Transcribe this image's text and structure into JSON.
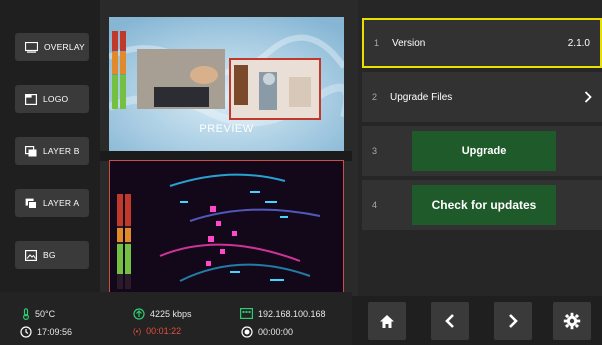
{
  "sources": [
    {
      "label": "OVERLAY",
      "icon": "overlay-icon"
    },
    {
      "label": "LOGO",
      "icon": "logo-icon"
    },
    {
      "label": "LAYER B",
      "icon": "layer-b-icon"
    },
    {
      "label": "LAYER A",
      "icon": "layer-a-icon"
    },
    {
      "label": "BG",
      "icon": "image-icon"
    }
  ],
  "preview": {
    "label": "PREVIEW"
  },
  "status": {
    "temperature": "50°C",
    "bitrate": "4225 kbps",
    "ip": "192.168.100.168",
    "clock": "17:09:56",
    "live_time": "00:01:22",
    "record_time": "00:00:00"
  },
  "menu": {
    "rows": [
      {
        "num": "1",
        "label": "Version",
        "value": "2.1.0"
      },
      {
        "num": "2",
        "label": "Upgrade Files"
      },
      {
        "num": "3",
        "button": "Upgrade"
      },
      {
        "num": "4",
        "button": "Check for updates"
      }
    ]
  },
  "colors": {
    "accent_selected": "#e8e000",
    "green_button": "#1f5a2a",
    "program_border": "#d24b4b",
    "status_green": "#2ecc71",
    "status_red": "#e74c3c"
  },
  "nav": [
    "home-icon",
    "back-arrow-icon",
    "forward-arrow-icon",
    "settings-icon"
  ]
}
